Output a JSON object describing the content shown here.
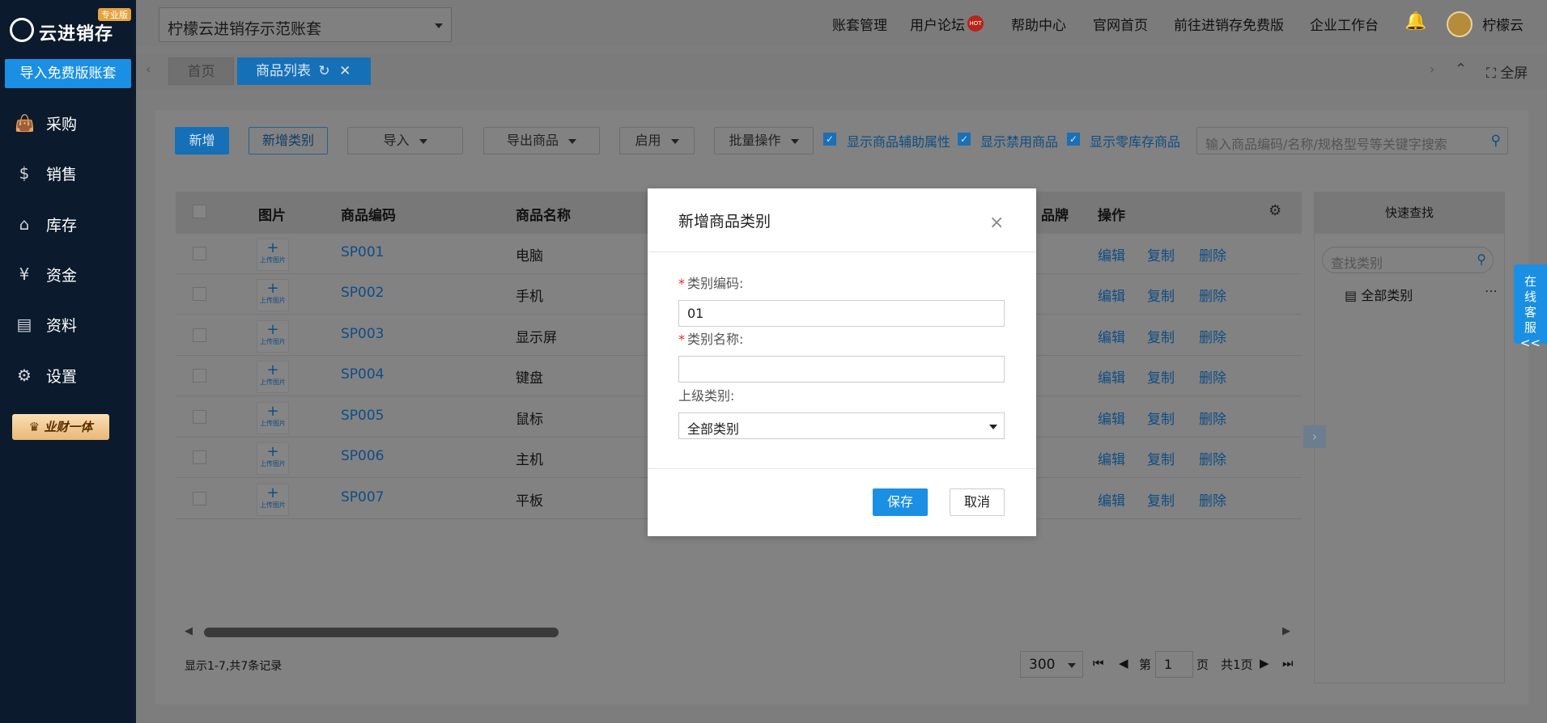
{
  "app": {
    "logo_text": "云进销存",
    "edition_badge": "专业版",
    "import_button": "导入免费版账套",
    "promo": "业财一体"
  },
  "sidebar": {
    "items": [
      {
        "label": "采购",
        "icon": "shopping-bag-icon"
      },
      {
        "label": "销售",
        "icon": "money-tag-icon"
      },
      {
        "label": "库存",
        "icon": "warehouse-icon"
      },
      {
        "label": "资金",
        "icon": "yen-coin-icon"
      },
      {
        "label": "资料",
        "icon": "document-icon"
      },
      {
        "label": "设置",
        "icon": "gear-icon"
      }
    ]
  },
  "header": {
    "account_selected": "柠檬云进销存示范账套",
    "links": [
      "账套管理",
      "用户论坛",
      "帮助中心",
      "官网首页",
      "前往进销存免费版",
      "企业工作台"
    ],
    "hot_badge": "HOT",
    "username": "柠檬云"
  },
  "tabs": {
    "home": "首页",
    "products": "商品列表",
    "fullscreen": "全屏"
  },
  "toolbar": {
    "new": "新增",
    "new_category": "新增类别",
    "import": "导入",
    "export": "导出商品",
    "enable": "启用",
    "batch": "批量操作",
    "check_aux": "显示商品辅助属性",
    "check_disabled": "显示禁用商品",
    "check_zero": "显示零库存商品",
    "search_placeholder": "输入商品编码/名称/规格型号等关键字搜索"
  },
  "table": {
    "columns": {
      "image": "图片",
      "code": "商品编码",
      "name": "商品名称",
      "brand": "品牌",
      "actions": "操作"
    },
    "upload_label": "上传图片",
    "action_labels": {
      "edit": "编辑",
      "copy": "复制",
      "delete": "删除"
    },
    "rows": [
      {
        "code": "SP001",
        "name": "电脑"
      },
      {
        "code": "SP002",
        "name": "手机"
      },
      {
        "code": "SP003",
        "name": "显示屏"
      },
      {
        "code": "SP004",
        "name": "键盘"
      },
      {
        "code": "SP005",
        "name": "鼠标"
      },
      {
        "code": "SP006",
        "name": "主机"
      },
      {
        "code": "SP007",
        "name": "平板"
      }
    ]
  },
  "footer": {
    "records": "显示1-7,共7条记录",
    "page_size": "300",
    "page_prefix": "第",
    "page_current": "1",
    "page_suffix": "页",
    "page_total": "共1页"
  },
  "quick_find": {
    "title": "快速查找",
    "search_placeholder": "查找类别",
    "root": "全部类别"
  },
  "chat": {
    "label": "在线客服<<"
  },
  "modal": {
    "title": "新增商品类别",
    "code_label": "类别编码:",
    "code_value": "01",
    "name_label": "类别名称:",
    "name_value": "",
    "parent_label": "上级类别:",
    "parent_value": "全部类别",
    "save": "保存",
    "cancel": "取消"
  }
}
